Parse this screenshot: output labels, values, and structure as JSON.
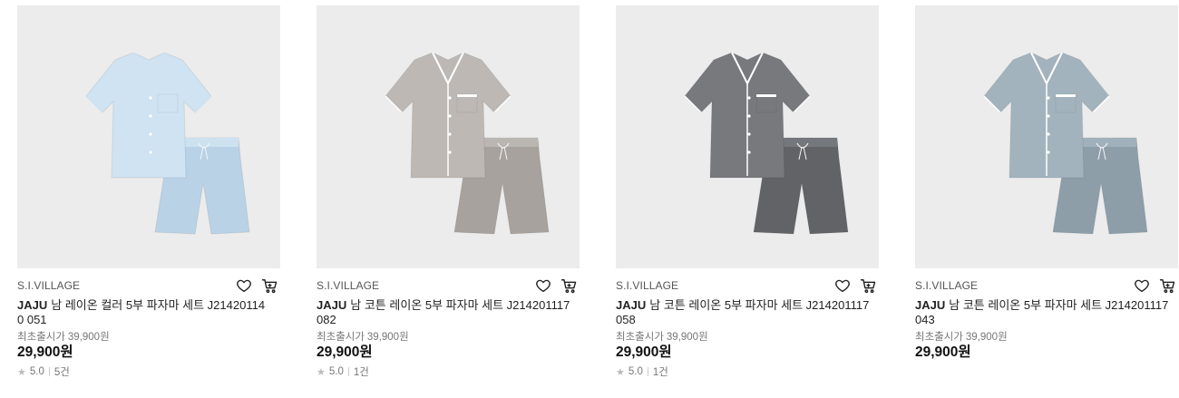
{
  "products": [
    {
      "brand": "S.I.VILLAGE",
      "title_brand": "JAJU",
      "title": "남 레이온 컬러 5부 파자마 세트 J214201140 051",
      "orig_label": "최초출시가",
      "orig_price": "39,900원",
      "price": "29,900원",
      "rating": "5.0",
      "reviews": "5건",
      "garment_color": "#cfe3f2",
      "garment_shade": "#b9d2e6",
      "piping_color": "#cfe3f2",
      "icons": [
        "heart-icon",
        "cart-icon",
        "star-icon"
      ]
    },
    {
      "brand": "S.I.VILLAGE",
      "title_brand": "JAJU",
      "title": "남 코튼 레이온 5부 파자마 세트 J214201117 082",
      "orig_label": "최초출시가",
      "orig_price": "39,900원",
      "price": "29,900원",
      "rating": "5.0",
      "reviews": "1건",
      "garment_color": "#bdb8b4",
      "garment_shade": "#a7a29e",
      "piping_color": "#ffffff",
      "icons": [
        "heart-icon",
        "cart-icon",
        "star-icon"
      ]
    },
    {
      "brand": "S.I.VILLAGE",
      "title_brand": "JAJU",
      "title": "남 코튼 레이온 5부 파자마 세트 J214201117 058",
      "orig_label": "최초출시가",
      "orig_price": "39,900원",
      "price": "29,900원",
      "rating": "5.0",
      "reviews": "1건",
      "garment_color": "#77797d",
      "garment_shade": "#616367",
      "piping_color": "#ffffff",
      "icons": [
        "heart-icon",
        "cart-icon",
        "star-icon"
      ]
    },
    {
      "brand": "S.I.VILLAGE",
      "title_brand": "JAJU",
      "title": "남 코튼 레이온 5부 파자마 세트 J214201117 043",
      "orig_label": "최초출시가",
      "orig_price": "39,900원",
      "price": "29,900원",
      "garment_color": "#a3b3bd",
      "garment_shade": "#8d9ea9",
      "piping_color": "#ffffff",
      "icons": [
        "heart-icon",
        "cart-icon"
      ]
    }
  ]
}
